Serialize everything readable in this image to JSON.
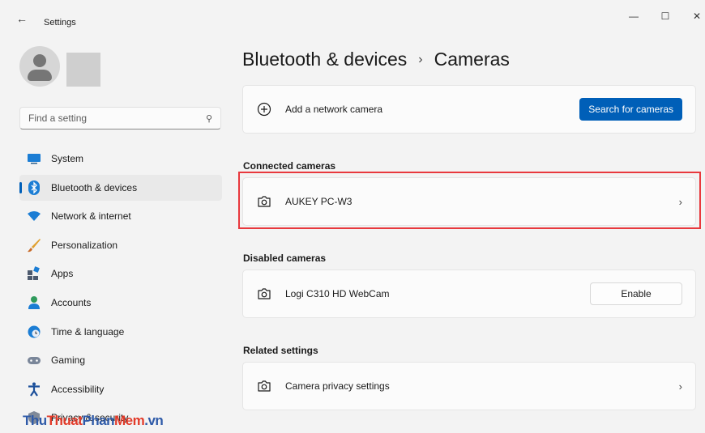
{
  "window": {
    "title": "Settings",
    "minimize": "—",
    "maximize": "☐",
    "close": "✕"
  },
  "search": {
    "placeholder": "Find a setting"
  },
  "nav": [
    {
      "label": "System",
      "icon": "monitor-icon",
      "active": false
    },
    {
      "label": "Bluetooth & devices",
      "icon": "bluetooth-icon",
      "active": true
    },
    {
      "label": "Network & internet",
      "icon": "wifi-icon",
      "active": false
    },
    {
      "label": "Personalization",
      "icon": "brush-icon",
      "active": false
    },
    {
      "label": "Apps",
      "icon": "apps-icon",
      "active": false
    },
    {
      "label": "Accounts",
      "icon": "person-icon",
      "active": false
    },
    {
      "label": "Time & language",
      "icon": "globe-clock-icon",
      "active": false
    },
    {
      "label": "Gaming",
      "icon": "gamepad-icon",
      "active": false
    },
    {
      "label": "Accessibility",
      "icon": "accessibility-icon",
      "active": false
    },
    {
      "label": "Privacy & security",
      "icon": "shield-icon",
      "active": false
    }
  ],
  "breadcrumb": {
    "parent": "Bluetooth & devices",
    "separator": "›",
    "current": "Cameras"
  },
  "add_camera": {
    "label": "Add a network camera",
    "button": "Search for cameras"
  },
  "connected": {
    "heading": "Connected cameras",
    "items": [
      {
        "label": "AUKEY PC-W3"
      }
    ]
  },
  "disabled": {
    "heading": "Disabled cameras",
    "items": [
      {
        "label": "Logi C310 HD WebCam",
        "button": "Enable"
      }
    ]
  },
  "related": {
    "heading": "Related settings",
    "items": [
      {
        "label": "Camera privacy settings"
      }
    ]
  },
  "watermark": {
    "part1": "Thu",
    "part2": "Thuat",
    "part3": "Phan",
    "part4": "Mem",
    "part5": ".vn"
  },
  "colors": {
    "accent": "#005fb8",
    "highlight": "#e8383d"
  }
}
